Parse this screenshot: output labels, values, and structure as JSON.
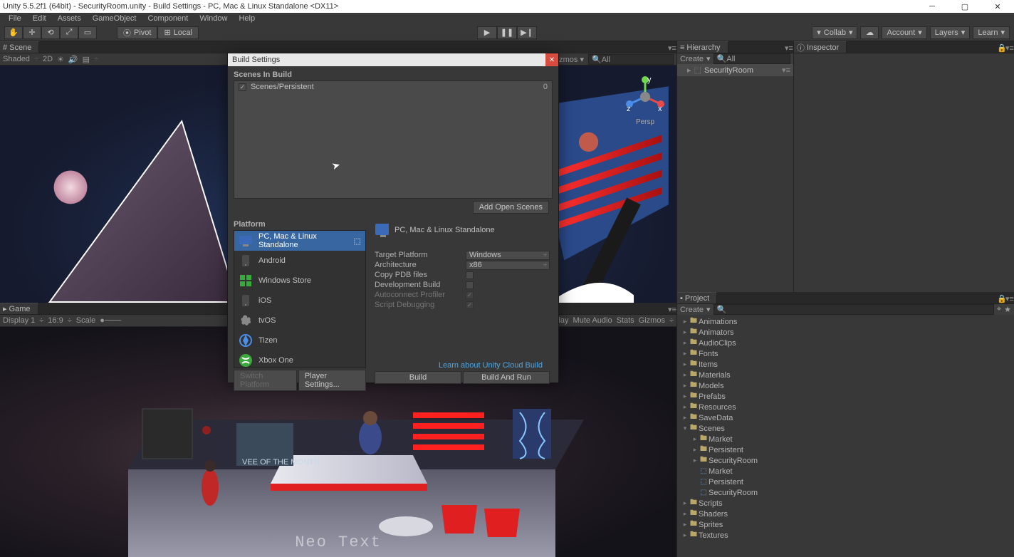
{
  "title": "Unity 5.5.2f1 (64bit) - SecurityRoom.unity - Build Settings - PC, Mac & Linux Standalone <DX11>",
  "menu": [
    "File",
    "Edit",
    "Assets",
    "GameObject",
    "Component",
    "Window",
    "Help"
  ],
  "toolbar": {
    "pivot": "Pivot",
    "local": "Local",
    "collab": "Collab",
    "account": "Account",
    "layers": "Layers",
    "layout": "Learn"
  },
  "scene_tab": "Scene",
  "scene_bar": {
    "shaded": "Shaded",
    "mode": "2D",
    "persp": "Persp",
    "all": "All"
  },
  "game_tab": "Game",
  "game_bar": {
    "display": "Display 1",
    "aspect": "16:9",
    "scale": "Scale",
    "onplay": "e On Play",
    "mute": "Mute Audio",
    "stats": "Stats",
    "gizmos": "Gizmos"
  },
  "hierarchy": {
    "tab": "Hierarchy",
    "create": "Create",
    "search_ph": "All",
    "root": "SecurityRoom"
  },
  "inspector": {
    "tab": "Inspector"
  },
  "project": {
    "tab": "Project",
    "create": "Create",
    "tree": [
      {
        "name": "Animations",
        "depth": 0,
        "type": "folder",
        "fold": "▸"
      },
      {
        "name": "Animators",
        "depth": 0,
        "type": "folder",
        "fold": "▸"
      },
      {
        "name": "AudioClips",
        "depth": 0,
        "type": "folder",
        "fold": "▸"
      },
      {
        "name": "Fonts",
        "depth": 0,
        "type": "folder",
        "fold": "▸"
      },
      {
        "name": "Items",
        "depth": 0,
        "type": "folder",
        "fold": "▸"
      },
      {
        "name": "Materials",
        "depth": 0,
        "type": "folder",
        "fold": "▸"
      },
      {
        "name": "Models",
        "depth": 0,
        "type": "folder",
        "fold": "▸"
      },
      {
        "name": "Prefabs",
        "depth": 0,
        "type": "folder",
        "fold": "▸"
      },
      {
        "name": "Resources",
        "depth": 0,
        "type": "folder",
        "fold": "▸"
      },
      {
        "name": "SaveData",
        "depth": 0,
        "type": "folder",
        "fold": "▸"
      },
      {
        "name": "Scenes",
        "depth": 0,
        "type": "folder",
        "fold": "▾"
      },
      {
        "name": "Market",
        "depth": 1,
        "type": "folder",
        "fold": "▸"
      },
      {
        "name": "Persistent",
        "depth": 1,
        "type": "folder",
        "fold": "▸"
      },
      {
        "name": "SecurityRoom",
        "depth": 1,
        "type": "folder",
        "fold": "▸"
      },
      {
        "name": "Market",
        "depth": 1,
        "type": "scene",
        "fold": ""
      },
      {
        "name": "Persistent",
        "depth": 1,
        "type": "scene",
        "fold": ""
      },
      {
        "name": "SecurityRoom",
        "depth": 1,
        "type": "scene",
        "fold": ""
      },
      {
        "name": "Scripts",
        "depth": 0,
        "type": "folder",
        "fold": "▸"
      },
      {
        "name": "Shaders",
        "depth": 0,
        "type": "folder",
        "fold": "▸"
      },
      {
        "name": "Sprites",
        "depth": 0,
        "type": "folder",
        "fold": "▸"
      },
      {
        "name": "Textures",
        "depth": 0,
        "type": "folder",
        "fold": "▸"
      }
    ]
  },
  "dialog": {
    "title": "Build Settings",
    "scenes_header": "Scenes In Build",
    "scenes": [
      {
        "checked": true,
        "name": "Scenes/Persistent",
        "index": "0"
      }
    ],
    "add_open": "Add Open Scenes",
    "platform_header": "Platform",
    "platforms": [
      {
        "label": "PC, Mac & Linux Standalone",
        "selected": true,
        "badge": true
      },
      {
        "label": "Android"
      },
      {
        "label": "Windows Store"
      },
      {
        "label": "iOS"
      },
      {
        "label": "tvOS"
      },
      {
        "label": "Tizen"
      },
      {
        "label": "Xbox One"
      }
    ],
    "right_title": "PC, Mac & Linux Standalone",
    "settings": {
      "target_label": "Target Platform",
      "target_value": "Windows",
      "arch_label": "Architecture",
      "arch_value": "x86",
      "pdb_label": "Copy PDB files",
      "pdb_checked": false,
      "dev_label": "Development Build",
      "dev_checked": false,
      "profiler_label": "Autoconnect Profiler",
      "profiler_checked": true,
      "profiler_disabled": true,
      "debug_label": "Script Debugging",
      "debug_checked": true,
      "debug_disabled": true
    },
    "cloud_link": "Learn about Unity Cloud Build",
    "switch": "Switch Platform",
    "player": "Player Settings...",
    "build": "Build",
    "build_run": "Build And Run"
  },
  "neo_text": "Neo Text"
}
